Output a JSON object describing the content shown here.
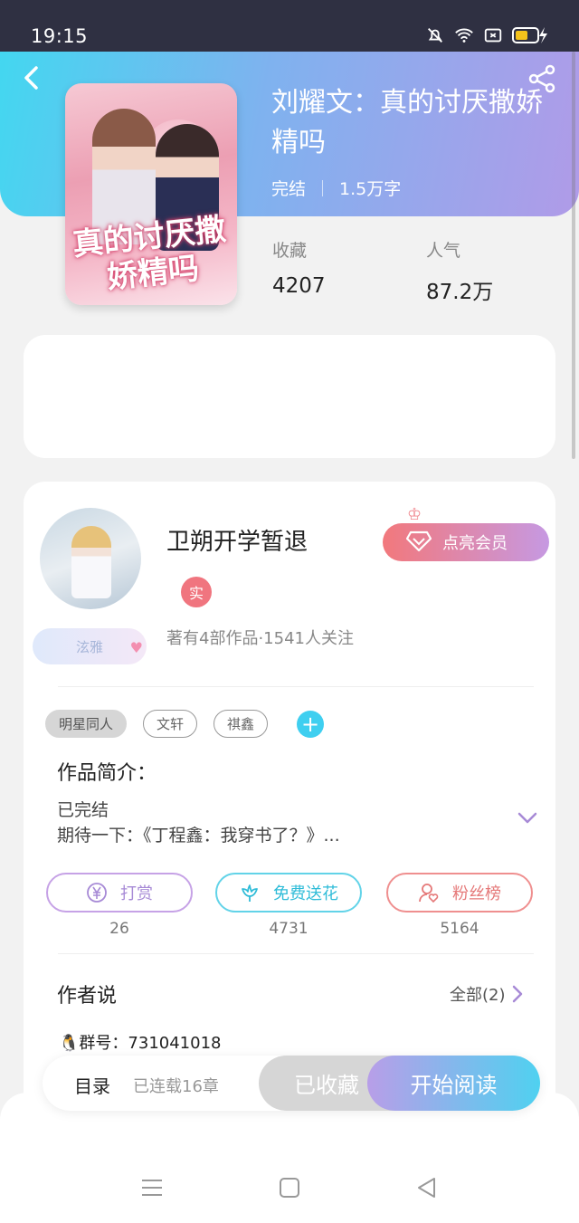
{
  "status_bar": {
    "time": "19:15"
  },
  "book": {
    "title": "刘耀文：真的讨厌撒娇精吗",
    "cover_title": "真的讨厌撒娇精吗",
    "status": "完结",
    "word_count": "1.5万字",
    "stats": [
      {
        "label": "收藏",
        "value": "4207"
      },
      {
        "label": "人气",
        "value": "87.2万"
      }
    ]
  },
  "author": {
    "name": "卫朔开学暂退",
    "badge_name": "泫雅",
    "real_badge": "实",
    "info": "著有4部作品·1541人关注",
    "vip_label": "点亮会员"
  },
  "tags": [
    "明星同人",
    "文轩",
    "祺鑫"
  ],
  "intro": {
    "label": "作品简介：",
    "status_line": "已完结",
    "text": "期待一下：《丁程鑫：我穿书了？》..."
  },
  "actions": [
    {
      "label": "打赏",
      "count": "26"
    },
    {
      "label": "免费送花",
      "count": "4731"
    },
    {
      "label": "粉丝榜",
      "count": "5164"
    }
  ],
  "author_says": {
    "label": "作者说",
    "all_label": "全部(2)",
    "first_item": "🐧群号：731041018"
  },
  "bottom_bar": {
    "toc": "目录",
    "chapters": "已连载16章",
    "favorited": "已收藏",
    "start_reading": "开始阅读"
  },
  "colors": {
    "header_gradient": [
      "#43d7f0",
      "#b09be8"
    ],
    "vip_gradient": [
      "#f2787c",
      "#c699e2"
    ],
    "read_gradient": [
      "#b89ee8",
      "#4fd1f0"
    ]
  }
}
